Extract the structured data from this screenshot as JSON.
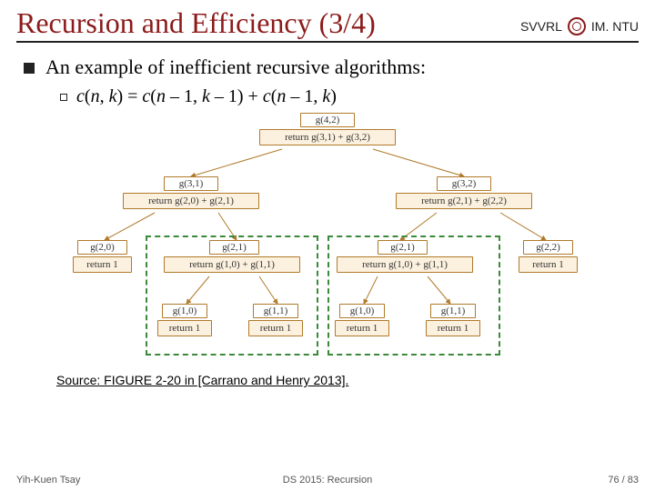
{
  "header": {
    "title": "Recursion and Efficiency (3/4)",
    "affil_left": "SVVRL",
    "affil_right": "IM. NTU"
  },
  "body": {
    "lvl1_text": "An example of inefficient recursive algorithms:",
    "formula_html": "c(n, k) = c(n – 1, k – 1) + c(n – 1, k)"
  },
  "diagram": {
    "root": {
      "call": "g(4,2)",
      "ret": "return g(3,1) + g(3,2)"
    },
    "l2a": {
      "call": "g(3,1)",
      "ret": "return g(2,0) + g(2,1)"
    },
    "l2b": {
      "call": "g(3,2)",
      "ret": "return g(2,1) + g(2,2)"
    },
    "l3a": {
      "call": "g(2,0)",
      "ret": "return 1"
    },
    "l3b": {
      "call": "g(2,1)",
      "ret": "return g(1,0) + g(1,1)"
    },
    "l3c": {
      "call": "g(2,1)",
      "ret": "return g(1,0) + g(1,1)"
    },
    "l3d": {
      "call": "g(2,2)",
      "ret": "return 1"
    },
    "l4a": {
      "call": "g(1,0)",
      "ret": "return 1"
    },
    "l4b": {
      "call": "g(1,1)",
      "ret": "return 1"
    },
    "l4c": {
      "call": "g(1,0)",
      "ret": "return 1"
    },
    "l4d": {
      "call": "g(1,1)",
      "ret": "return 1"
    }
  },
  "caption": "Source: FIGURE 2-20 in [Carrano and Henry 2013].",
  "footer": {
    "left": "Yih-Kuen Tsay",
    "center": "DS 2015: Recursion",
    "right": "76 / 83"
  }
}
